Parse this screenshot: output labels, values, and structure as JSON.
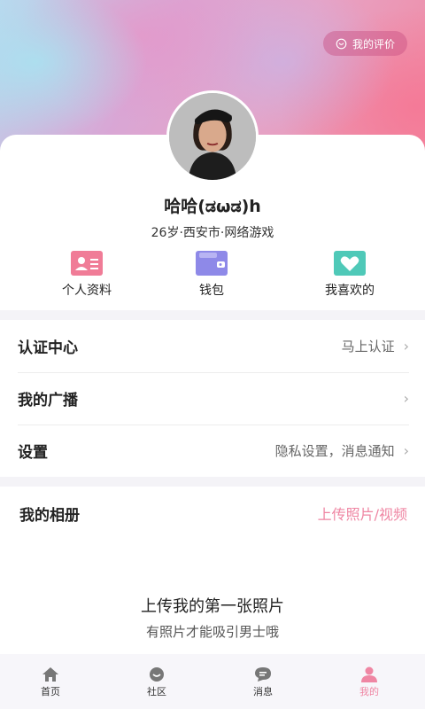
{
  "header": {
    "rating_label": "我的评价"
  },
  "profile": {
    "nickname": "哈哈(ಡωಡ)h",
    "info": "26岁·西安市·网络游戏"
  },
  "quick_actions": [
    {
      "label": "个人资料",
      "icon": "id-card-icon",
      "color": "#f07c97"
    },
    {
      "label": "钱包",
      "icon": "wallet-icon",
      "color": "#8e89e8"
    },
    {
      "label": "我喜欢的",
      "icon": "heart-icon",
      "color": "#4fc9b8"
    }
  ],
  "menu": [
    {
      "title": "认证中心",
      "value": "马上认证"
    },
    {
      "title": "我的广播",
      "value": ""
    },
    {
      "title": "设置",
      "value": "隐私设置，消息通知"
    }
  ],
  "album": {
    "title": "我的相册",
    "upload_label": "上传照片/视频",
    "empty_title": "上传我的第一张照片",
    "empty_subtitle": "有照片才能吸引男士哦"
  },
  "tabs": [
    {
      "label": "首页",
      "icon": "home-icon"
    },
    {
      "label": "社区",
      "icon": "community-icon"
    },
    {
      "label": "消息",
      "icon": "message-icon"
    },
    {
      "label": "我的",
      "icon": "me-icon",
      "active": true
    }
  ],
  "colors": {
    "accent": "#ef86a3",
    "background": "#f4f3f7"
  }
}
